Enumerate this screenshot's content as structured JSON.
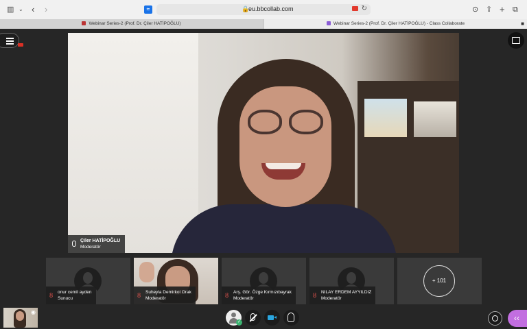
{
  "browser": {
    "url": "eu.bbcollab.com",
    "tabs": [
      {
        "title": "Webinar Series-2 (Prof. Dr. Çiler HATİPOĞLU)"
      },
      {
        "title": "Webinar Series-2 (Prof. Dr. Çiler HATİPOĞLU) - Class Collaborate"
      }
    ]
  },
  "main_speaker": {
    "name": "Çiler HATİPOĞLU",
    "role": "Moderatör"
  },
  "participants": [
    {
      "name": "onur cemil ayden",
      "role": "Sunucu"
    },
    {
      "name": "Suheyla Demirkol Orak",
      "role": "Moderatör"
    },
    {
      "name": "Arş. Gör. Özge Kırmızıbayrak",
      "role": "Moderatör"
    },
    {
      "name": "NILAY ERDEM AYYILDIZ",
      "role": "Moderatör"
    }
  ],
  "more_participants": "+ 101",
  "colors": {
    "accent": "#c26ee0",
    "muted_mic": "#e8544e",
    "camera_on": "#2aa6e0",
    "status_ok": "#3cb371"
  },
  "icons": {
    "mute": "🎙",
    "check": "✓",
    "eye": "◉",
    "chevron": "‹‹",
    "lock": "🔒",
    "reload": "↻"
  }
}
